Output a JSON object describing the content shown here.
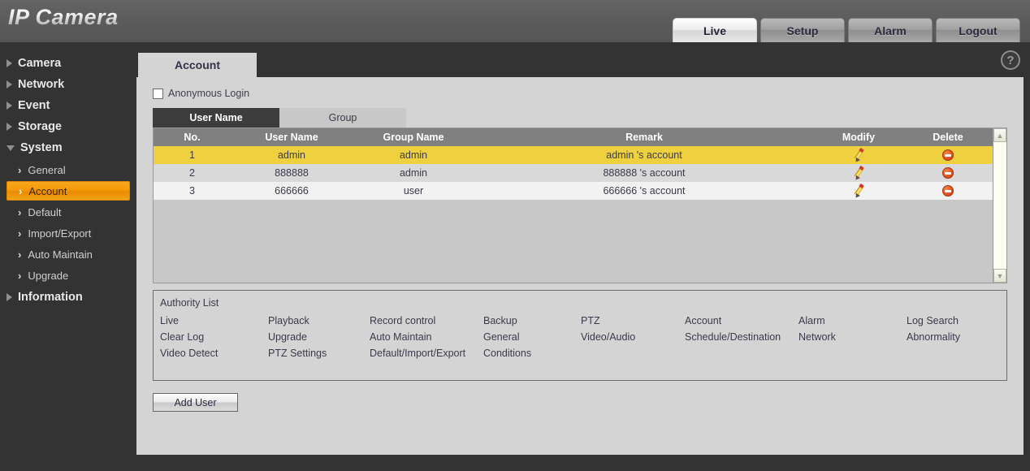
{
  "header": {
    "brand_ip": "IP",
    "brand_camera": " Camera",
    "tabs": [
      {
        "label": "Live",
        "active": true
      },
      {
        "label": "Setup",
        "active": false
      },
      {
        "label": "Alarm",
        "active": false
      },
      {
        "label": "Logout",
        "active": false
      }
    ]
  },
  "sidebar": {
    "items": [
      {
        "label": "Camera",
        "expanded": false
      },
      {
        "label": "Network",
        "expanded": false
      },
      {
        "label": "Event",
        "expanded": false
      },
      {
        "label": "Storage",
        "expanded": false
      },
      {
        "label": "System",
        "expanded": true
      },
      {
        "label": "Information",
        "expanded": false
      }
    ],
    "system_children": [
      {
        "label": "General",
        "active": false
      },
      {
        "label": "Account",
        "active": true
      },
      {
        "label": "Default",
        "active": false
      },
      {
        "label": "Import/Export",
        "active": false
      },
      {
        "label": "Auto Maintain",
        "active": false
      },
      {
        "label": "Upgrade",
        "active": false
      }
    ]
  },
  "panel": {
    "tab_label": "Account",
    "help_glyph": "?",
    "anonymous_login": {
      "label": "Anonymous Login",
      "checked": false
    },
    "subtabs": [
      {
        "label": "User Name",
        "active": true
      },
      {
        "label": "Group",
        "active": false
      }
    ],
    "table": {
      "columns": [
        "No.",
        "User Name",
        "Group Name",
        "Remark",
        "Modify",
        "Delete"
      ],
      "rows": [
        {
          "no": "1",
          "user_name": "admin",
          "group_name": "admin",
          "remark": "admin 's account",
          "highlighted": true
        },
        {
          "no": "2",
          "user_name": "888888",
          "group_name": "admin",
          "remark": "888888 's account",
          "highlighted": false
        },
        {
          "no": "3",
          "user_name": "666666",
          "group_name": "user",
          "remark": "666666 's account",
          "highlighted": false
        }
      ],
      "scroll_up_glyph": "▲",
      "scroll_down_glyph": "▼"
    },
    "authority": {
      "title": "Authority List",
      "items": [
        "Live",
        "Playback",
        "Record control",
        "Backup",
        "PTZ",
        "Account",
        "Alarm",
        "Log Search",
        "Clear Log",
        "Upgrade",
        "Auto Maintain",
        "General",
        "Video/Audio",
        "Schedule/Destination",
        "Network",
        "Abnormality",
        "Video Detect",
        "PTZ Settings",
        "Default/Import/Export",
        "Conditions",
        "",
        "",
        "",
        ""
      ]
    },
    "add_user_label": "Add User"
  },
  "colors": {
    "accent_orange": "#f59a09",
    "row_highlight": "#efd13f",
    "header_gray": "#808080",
    "panel_bg": "#d4d4d4",
    "body_dark": "#333333"
  }
}
